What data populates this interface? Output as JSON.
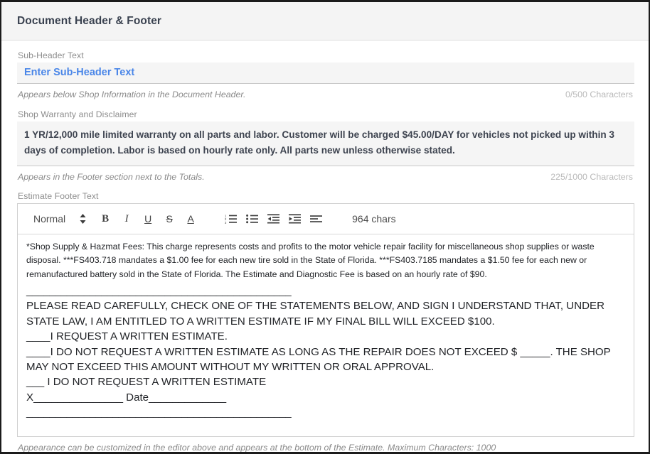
{
  "panel": {
    "title": "Document Header & Footer"
  },
  "sub_header": {
    "label": "Sub-Header Text",
    "placeholder": "Enter Sub-Header Text",
    "value": "",
    "hint": "Appears below Shop Information in the Document Header.",
    "counter": "0/500 Characters"
  },
  "warranty": {
    "label": "Shop Warranty and Disclaimer",
    "value": "1 YR/12,000 mile limited warranty on all parts and labor. Customer will be charged $45.00/DAY for vehicles not picked up within 3 days of completion. Labor is based on hourly rate only.  All parts new unless otherwise stated.",
    "hint": "Appears in the Footer section next to the Totals.",
    "counter": "225/1000 Characters"
  },
  "editor": {
    "label": "Estimate Footer Text",
    "toolbar": {
      "format_select": "Normal",
      "bold": "B",
      "italic": "I",
      "underline": "U",
      "strike": "S",
      "text_color": "A",
      "ordered_list": "ordered-list",
      "bullet_list": "bullet-list",
      "outdent": "outdent",
      "indent": "indent",
      "align": "align",
      "char_count": "964 chars"
    },
    "content": {
      "paragraph_small": "*Shop Supply & Hazmat Fees: This charge represents costs and profits to the motor vehicle repair facility for miscellaneous shop supplies or waste disposal. ***FS403.718 mandates a $1.00 fee for each new tire sold in the State of Florida. ***FS403.7185 mandates a $1.50 fee for each new or remanufactured battery sold in the State of Florida. The Estimate and Diagnostic Fee is based on an hourly rate of $90.",
      "divider_top": "______________________________________________",
      "lines": [
        "PLEASE READ CAREFULLY, CHECK ONE OF THE STATEMENTS BELOW, AND SIGN I UNDERSTAND THAT, UNDER STATE LAW, I AM ENTITLED TO A WRITTEN ESTIMATE IF MY FINAL BILL WILL EXCEED $100.",
        "____I REQUEST A WRITTEN ESTIMATE.",
        "____I DO NOT REQUEST A WRITTEN ESTIMATE AS LONG AS THE REPAIR DOES NOT EXCEED $ _____. THE SHOP MAY NOT EXCEED THIS AMOUNT WITHOUT MY WRITTEN OR ORAL APPROVAL.",
        "___ I DO NOT REQUEST A WRITTEN ESTIMATE",
        "X_______________ Date_____________"
      ],
      "divider_bottom": "______________________________________________"
    },
    "hint": "Appearance can be customized in the editor above and appears at the bottom of the Estimate. Maximum Characters: 1000"
  },
  "colors": {
    "header_bg": "#f4f4f4",
    "placeholder_blue": "#4a86e8",
    "field_bg": "#f5f5f5",
    "hint_gray": "#8a8a8a",
    "counter_gray": "#b9b9b9"
  }
}
